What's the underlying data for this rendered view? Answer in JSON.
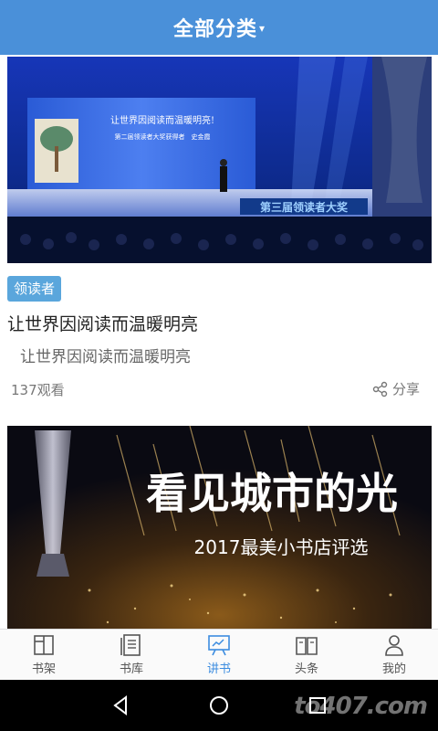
{
  "header": {
    "title": "全部分类",
    "caret": "▾"
  },
  "card1": {
    "image": {
      "banner_text": "让世界因阅读而温暖明亮!",
      "banner_sub": "第二届领读者大奖获得者　史金霞",
      "stage_text": "第三届领读者大奖"
    },
    "tag": "领读者",
    "title": "让世界因阅读而温暖明亮",
    "subtitle": "让世界因阅读而温暖明亮",
    "views": "137观看",
    "share_label": "分享"
  },
  "card2": {
    "image": {
      "headline": "看见城市的光",
      "sub": "2017最美小书店评选"
    }
  },
  "nav": {
    "items": [
      {
        "label": "书架",
        "icon": "bookshelf-icon"
      },
      {
        "label": "书库",
        "icon": "library-icon"
      },
      {
        "label": "讲书",
        "icon": "presentation-icon",
        "active": true
      },
      {
        "label": "头条",
        "icon": "open-book-icon"
      },
      {
        "label": "我的",
        "icon": "person-icon"
      }
    ],
    "active_color": "#3d8de0"
  },
  "colors": {
    "header": "#4a90d9",
    "tag": "#5aa6dc"
  },
  "watermark": "to407.com"
}
